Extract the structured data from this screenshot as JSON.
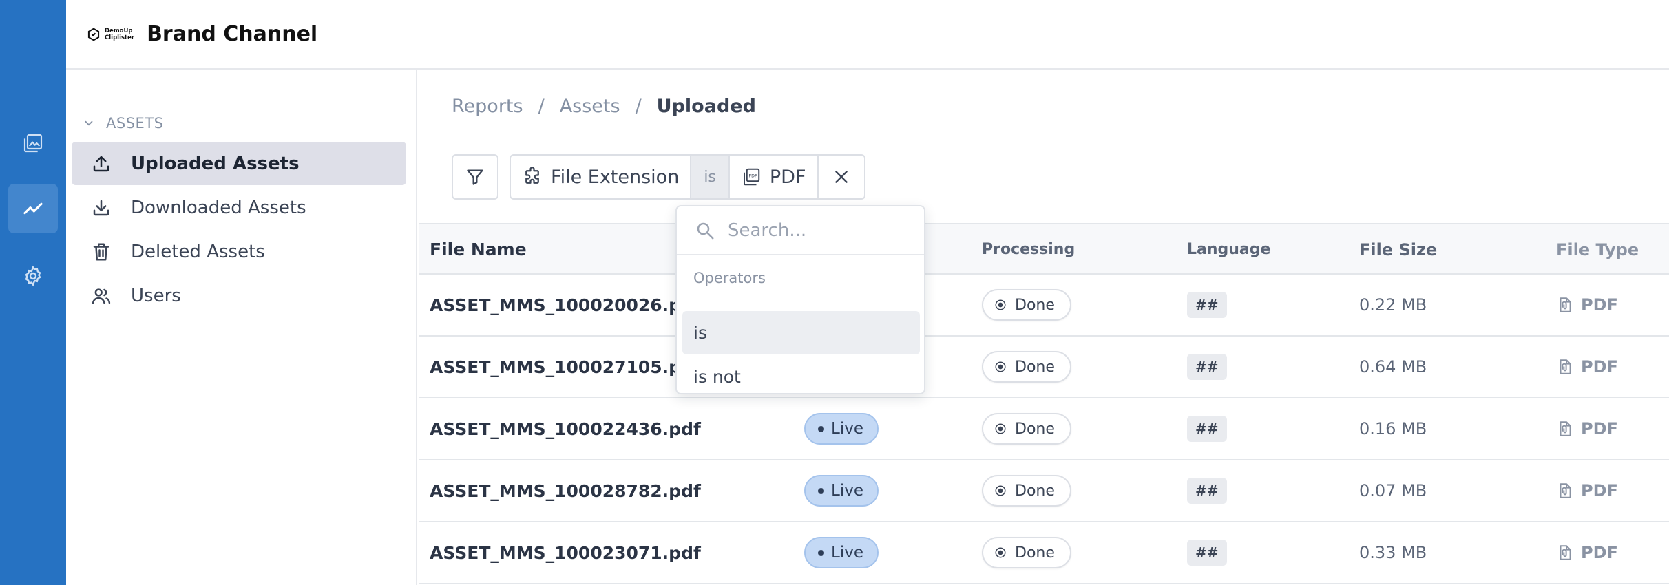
{
  "header": {
    "logo_line1": "DemoUp",
    "logo_line2": "Cliplister",
    "title": "Brand Channel"
  },
  "rail": {
    "items": [
      {
        "icon": "gallery-icon",
        "active": false
      },
      {
        "icon": "trend-chart-icon",
        "active": true
      },
      {
        "icon": "gear-icon",
        "active": false
      }
    ]
  },
  "sidebar": {
    "section_label": "ASSETS",
    "items": [
      {
        "label": "Uploaded Assets",
        "icon": "upload-icon",
        "active": true
      },
      {
        "label": "Downloaded Assets",
        "icon": "download-icon",
        "active": false
      },
      {
        "label": "Deleted Assets",
        "icon": "trash-icon",
        "active": false
      },
      {
        "label": "Users",
        "icon": "users-icon",
        "active": false
      }
    ]
  },
  "breadcrumb": {
    "items": [
      "Reports",
      "Assets",
      "Uploaded"
    ],
    "separator": "/"
  },
  "filter": {
    "field": "File Extension",
    "operator": "is",
    "value": "PDF"
  },
  "dropdown": {
    "search_placeholder": "Search...",
    "group_label": "Operators",
    "options": [
      "is",
      "is not"
    ],
    "highlighted": "is"
  },
  "table": {
    "columns": [
      "File Name",
      "Processing",
      "Language",
      "File Size",
      "File Type"
    ],
    "rows": [
      {
        "name": "ASSET_MMS_100020026.pdf",
        "status": "",
        "processing": "Done",
        "language": "##",
        "size": "0.22 MB",
        "type": "PDF"
      },
      {
        "name": "ASSET_MMS_100027105.pdf",
        "status": "",
        "processing": "Done",
        "language": "##",
        "size": "0.64 MB",
        "type": "PDF"
      },
      {
        "name": "ASSET_MMS_100022436.pdf",
        "status": "Live",
        "processing": "Done",
        "language": "##",
        "size": "0.16 MB",
        "type": "PDF"
      },
      {
        "name": "ASSET_MMS_100028782.pdf",
        "status": "Live",
        "processing": "Done",
        "language": "##",
        "size": "0.07 MB",
        "type": "PDF"
      },
      {
        "name": "ASSET_MMS_100023071.pdf",
        "status": "Live",
        "processing": "Done",
        "language": "##",
        "size": "0.33 MB",
        "type": "PDF"
      }
    ]
  },
  "colors": {
    "rail": "#2672c2",
    "rail_active": "#4386cd",
    "live_badge": "#c4d9f5",
    "nav_active": "#dedfe8"
  }
}
